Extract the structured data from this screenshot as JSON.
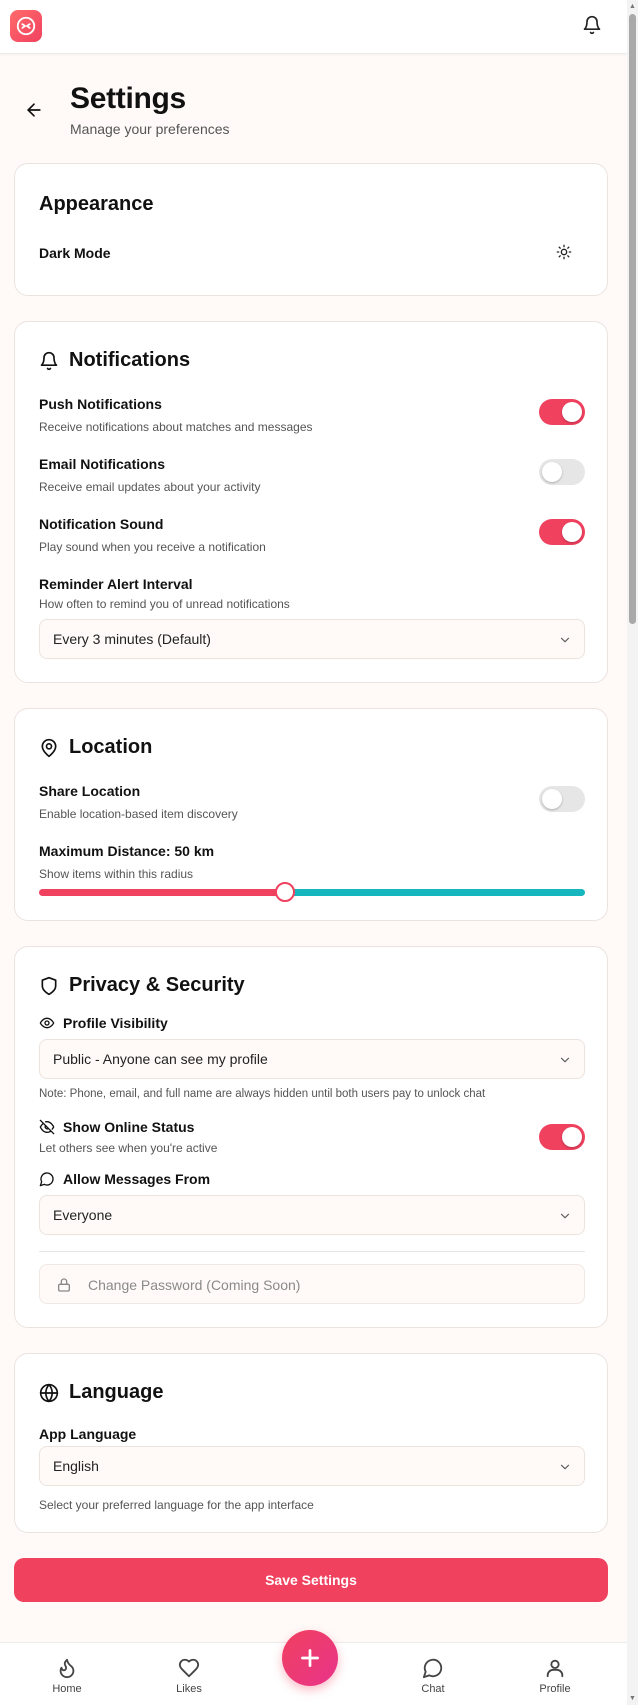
{
  "header": {
    "title": "Settings",
    "subtitle": "Manage your preferences"
  },
  "appearance": {
    "title": "Appearance",
    "dark_mode_label": "Dark Mode",
    "dark_mode_icon": "sun-icon"
  },
  "notifications": {
    "title": "Notifications",
    "push": {
      "label": "Push Notifications",
      "desc": "Receive notifications about matches and messages",
      "enabled": true
    },
    "email": {
      "label": "Email Notifications",
      "desc": "Receive email updates about your activity",
      "enabled": false
    },
    "sound": {
      "label": "Notification Sound",
      "desc": "Play sound when you receive a notification",
      "enabled": true
    },
    "reminder": {
      "label": "Reminder Alert Interval",
      "desc": "How often to remind you of unread notifications",
      "value": "Every 3 minutes (Default)"
    }
  },
  "location": {
    "title": "Location",
    "share": {
      "label": "Share Location",
      "desc": "Enable location-based item discovery",
      "enabled": false
    },
    "distance": {
      "label": "Maximum Distance: 50 km",
      "desc": "Show items within this radius",
      "fraction": 0.45
    }
  },
  "privacy": {
    "title": "Privacy & Security",
    "visibility_label": "Profile Visibility",
    "visibility_value": "Public - Anyone can see my profile",
    "note": "Note: Phone, email, and full name are always hidden until both users pay to unlock chat",
    "online": {
      "label": "Show Online Status",
      "desc": "Let others see when you're active",
      "enabled": true
    },
    "messages_label": "Allow Messages From",
    "messages_value": "Everyone",
    "password_label": "Change Password (Coming Soon)"
  },
  "language": {
    "title": "Language",
    "label": "App Language",
    "value": "English",
    "desc": "Select your preferred language for the app interface"
  },
  "save_label": "Save Settings",
  "nav": {
    "home": "Home",
    "likes": "Likes",
    "chat": "Chat",
    "profile": "Profile"
  },
  "colors": {
    "accent": "#f0415f",
    "teal": "#15b6bd"
  }
}
